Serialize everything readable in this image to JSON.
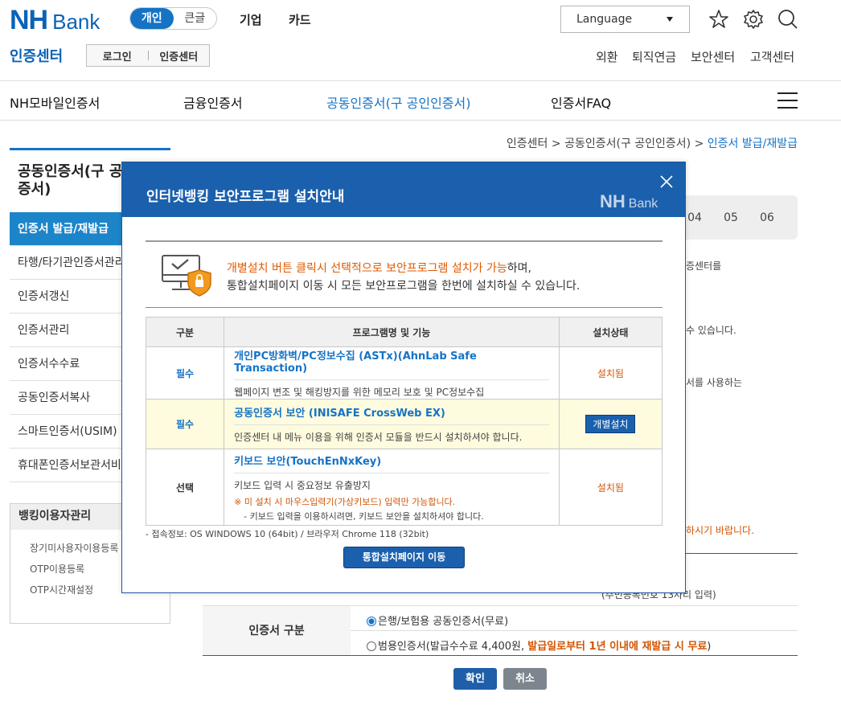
{
  "header": {
    "logo_nh": "NH",
    "logo_bank": "Bank",
    "segment": [
      "개인",
      "큰글"
    ],
    "top_nav": [
      "기업",
      "카드"
    ],
    "language_label": "Language",
    "brand_section": "인증센터",
    "login_links": [
      "로그인",
      "인증센터"
    ],
    "util_links": [
      "외환",
      "퇴직연금",
      "보안센터",
      "고객센터"
    ]
  },
  "gnb": {
    "items": [
      "NH모바일인증서",
      "금융인증서",
      "공동인증서(구 공인인증서)",
      "인증서FAQ"
    ],
    "active_index": 2
  },
  "breadcrumb": {
    "items": [
      "인증센터",
      "공동인증서(구 공인인증서)"
    ],
    "current": "인증서 발급/재발급",
    "sep": " > "
  },
  "lnb": {
    "title_line1": "공동인증서(구 공",
    "title_line2": "증서)",
    "items": [
      "인증서 발급/재발급",
      "타행/타기관인증서관리",
      "인증서갱신",
      "인증서관리",
      "인증서수수료",
      "공동인증서복사",
      "스마트인증서(USIM)",
      "휴대폰인증서보관서비"
    ],
    "active_index": 0,
    "sub_title": "뱅킹이용자관리",
    "sub_items": [
      "장기미사용자이용등록",
      "OTP이용등록",
      "OTP시간재설정"
    ]
  },
  "steps": [
    "04",
    "05",
    "06"
  ],
  "bg_text": {
    "t1": "증센터를",
    "t2": "수 있습니다.",
    "t3": "서를 사용하는",
    "t4": "하시기 바랍니다.",
    "row_partial": "(주민등록번호 13자리 입력)"
  },
  "form": {
    "label_cert_type": "인증서 구분",
    "option1": "은행/보험용 공동인증서(무료)",
    "option2_main": "범용인증서(발급수수료 4,400원, ",
    "option2_red": "발급일로부터 1년 이내에 재발급 시 무료",
    "option2_end": ")",
    "confirm": "확인",
    "cancel": "취소"
  },
  "modal": {
    "title": "인터넷뱅킹 보안프로그램 설치안내",
    "logo_nh": "NH",
    "logo_bank": "Bank",
    "msg1_highlight": "개별설치 버튼 클릭시 선택적으로 보안프로그램 설치가 가능",
    "msg1_rest": "하며,",
    "msg2": "통합설치페이지 이동 시 모든 보안프로그램을 한번에 설치하실 수 있습니다.",
    "table_headers": [
      "구분",
      "프로그램명 및 기능",
      "설치상태"
    ],
    "rows": [
      {
        "type": "필수",
        "name": "개인PC방화벽/PC정보수집 (ASTx)(AhnLab Safe Transaction)",
        "desc": "웹페이지 변조 및 해킹방지를 위한 메모리 보호 및 PC정보수집",
        "status": "설치됨"
      },
      {
        "type": "필수",
        "name": "공동인증서 보안 (INISAFE CrossWeb EX)",
        "desc": "인증센터 내 메뉴 이용을 위해 인증서 모듈을 반드시 설치하셔야 합니다.",
        "button": "개별설치"
      },
      {
        "type": "선택",
        "name": "키보드 보안(TouchEnNxKey)",
        "desc": "키보드 입력 시 중요정보 유출방지",
        "note": "※ 미 설치 시 마우스입력기(가상키보드) 입력만 가능합니다.",
        "note2": "- 키보드 입력을 이용하시려면, 키보드 보안을 설치하셔야 합니다.",
        "status": "설치됨"
      }
    ],
    "conn_info": "- 접속정보: OS WINDOWS 10 (64bit) / 브라우저 Chrome 118 (32bit)",
    "go_all_button": "통합설치페이지 이동"
  }
}
